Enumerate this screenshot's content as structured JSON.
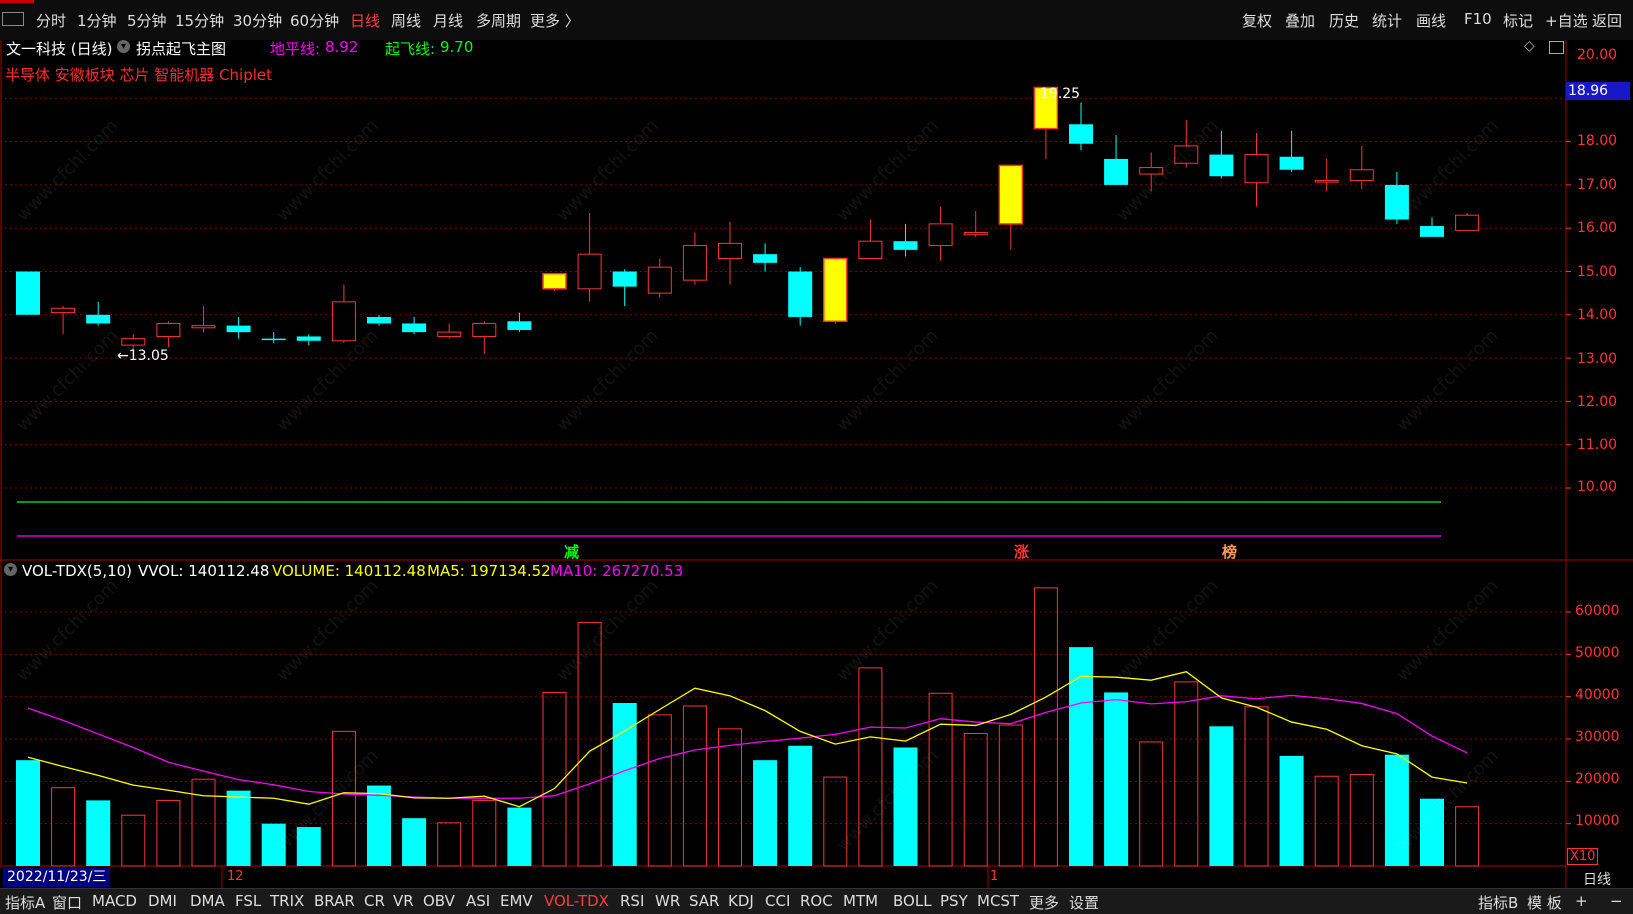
{
  "toolbar": {
    "periods": [
      "分时",
      "1分钟",
      "5分钟",
      "15分钟",
      "30分钟",
      "60分钟",
      "日线",
      "周线",
      "月线",
      "多周期",
      "更多 〉"
    ],
    "active_period": "日线",
    "right": [
      "复权",
      "叠加",
      "历史",
      "统计",
      "画线",
      "F10",
      "标记",
      "+自选",
      "返回"
    ]
  },
  "stock": {
    "title": "文一科技 (日线)",
    "main_chart": "拐点起飞主图",
    "floor_line_label": "地平线:",
    "floor_line_value": "8.92",
    "takeoff_line_label": "起飞线:",
    "takeoff_line_value": "9.70",
    "concepts": "半导体 安徽板块 芯片 智能机器 Chiplet",
    "last_price": "18.96",
    "high_label": "19.25",
    "low_label": "←13.05"
  },
  "indicator": {
    "name": "VOL-TDX(5,10)",
    "vvol": "VVOL: 140112.48",
    "volume": "VOLUME: 140112.48",
    "ma5": "MA5: 197134.52",
    "ma10": "MA10: 267270.53",
    "x10": "X10"
  },
  "signals": {
    "reduce": "减",
    "rise": "涨",
    "list": "榜"
  },
  "date": "2022/11/23/三",
  "month_marks": [
    "12",
    "1"
  ],
  "period_label": "日线",
  "bottom_tabs": [
    "指标A",
    "窗口",
    "MACD",
    "DMI",
    "DMA",
    "FSL",
    "TRIX",
    "BRAR",
    "CR",
    "VR",
    "OBV",
    "ASI",
    "EMV",
    "VOL-TDX",
    "RSI",
    "WR",
    "SAR",
    "KDJ",
    "CCI",
    "ROC",
    "MTM",
    "BOLL",
    "PSY",
    "MCST",
    "更多",
    "设置"
  ],
  "active_tab": "VOL-TDX",
  "bottom_right": [
    "指标B",
    "模 板",
    "+",
    "−"
  ],
  "watermark": "www.cfchi.com",
  "colors": {
    "up": "#ff3333",
    "down": "#00ffff",
    "yellow": "#ffff00",
    "magenta": "#ff00ff",
    "green": "#00ff00"
  },
  "chart_data": {
    "type": "candlestick",
    "price_axis": {
      "ylim": [
        9.0,
        20.4
      ],
      "ticks": [
        "10.00",
        "11.00",
        "12.00",
        "13.00",
        "14.00",
        "15.00",
        "16.00",
        "17.00",
        "18.00",
        "19.00",
        "20.00"
      ]
    },
    "volume_axis": {
      "ylim": [
        0,
        70000
      ],
      "ticks": [
        "10000",
        "20000",
        "30000",
        "40000",
        "50000",
        "60000"
      ],
      "unit": "X10"
    },
    "ohlc": [
      [
        15.0,
        15.0,
        14.0,
        14.0,
        "cyan"
      ],
      [
        14.05,
        14.2,
        13.55,
        14.15,
        "red"
      ],
      [
        14.0,
        14.3,
        13.75,
        13.8,
        "cyan"
      ],
      [
        13.3,
        13.55,
        13.05,
        13.45,
        "red"
      ],
      [
        13.5,
        13.85,
        13.25,
        13.8,
        "red"
      ],
      [
        13.7,
        14.2,
        13.6,
        13.75,
        "red"
      ],
      [
        13.75,
        13.95,
        13.45,
        13.6,
        "cyan"
      ],
      [
        13.45,
        13.6,
        13.35,
        13.45,
        "cyan"
      ],
      [
        13.4,
        13.55,
        13.3,
        13.5,
        "cyan"
      ],
      [
        13.4,
        14.7,
        13.35,
        14.3,
        "red"
      ],
      [
        13.95,
        14.0,
        13.75,
        13.8,
        "cyan"
      ],
      [
        13.8,
        13.95,
        13.55,
        13.6,
        "cyan"
      ],
      [
        13.5,
        13.8,
        13.45,
        13.6,
        "red"
      ],
      [
        13.5,
        13.85,
        13.1,
        13.8,
        "red"
      ],
      [
        13.85,
        14.05,
        13.6,
        13.65,
        "cyan"
      ],
      [
        14.6,
        14.95,
        14.55,
        14.95,
        "yellow"
      ],
      [
        14.6,
        16.35,
        14.3,
        15.4,
        "red"
      ],
      [
        15.0,
        15.05,
        14.2,
        14.65,
        "cyan"
      ],
      [
        14.5,
        15.3,
        14.4,
        15.1,
        "red"
      ],
      [
        14.8,
        15.9,
        14.7,
        15.6,
        "red"
      ],
      [
        15.3,
        16.15,
        14.7,
        15.65,
        "red"
      ],
      [
        15.4,
        15.65,
        15.0,
        15.2,
        "cyan"
      ],
      [
        15.0,
        15.1,
        13.75,
        13.95,
        "cyan"
      ],
      [
        13.85,
        15.3,
        13.8,
        15.3,
        "yellow"
      ],
      [
        15.3,
        16.2,
        15.3,
        15.7,
        "red"
      ],
      [
        15.7,
        16.1,
        15.35,
        15.5,
        "cyan"
      ],
      [
        15.6,
        16.5,
        15.25,
        16.1,
        "red"
      ],
      [
        15.85,
        16.4,
        15.8,
        15.9,
        "red"
      ],
      [
        16.1,
        17.45,
        15.5,
        17.45,
        "yellow"
      ],
      [
        18.3,
        19.25,
        17.6,
        19.25,
        "yellow"
      ],
      [
        18.4,
        18.9,
        17.8,
        17.95,
        "cyan"
      ],
      [
        17.6,
        18.15,
        17.0,
        17.0,
        "cyan"
      ],
      [
        17.25,
        17.75,
        16.85,
        17.4,
        "red"
      ],
      [
        17.5,
        18.5,
        17.4,
        17.9,
        "red"
      ],
      [
        17.7,
        18.25,
        17.15,
        17.2,
        "cyan"
      ],
      [
        17.05,
        18.2,
        16.5,
        17.7,
        "red"
      ],
      [
        17.65,
        18.25,
        17.3,
        17.35,
        "cyan"
      ],
      [
        17.1,
        17.6,
        16.85,
        17.1,
        "red"
      ],
      [
        17.1,
        17.9,
        16.9,
        17.35,
        "red"
      ],
      [
        17.0,
        17.3,
        16.1,
        16.2,
        "cyan"
      ],
      [
        16.05,
        16.25,
        15.8,
        15.8,
        "cyan"
      ],
      [
        15.95,
        16.35,
        15.95,
        16.3,
        "red"
      ]
    ],
    "volume": [
      [
        25000,
        "cyan"
      ],
      [
        18500,
        "red"
      ],
      [
        15500,
        "cyan"
      ],
      [
        12000,
        "red"
      ],
      [
        15500,
        "red"
      ],
      [
        20500,
        "red"
      ],
      [
        17800,
        "cyan"
      ],
      [
        10000,
        "cyan"
      ],
      [
        9200,
        "cyan"
      ],
      [
        31800,
        "red"
      ],
      [
        19000,
        "cyan"
      ],
      [
        11300,
        "cyan"
      ],
      [
        10200,
        "red"
      ],
      [
        15500,
        "red"
      ],
      [
        13800,
        "cyan"
      ],
      [
        41000,
        "red"
      ],
      [
        57500,
        "red"
      ],
      [
        38500,
        "cyan"
      ],
      [
        35700,
        "red"
      ],
      [
        37800,
        "red"
      ],
      [
        32400,
        "red"
      ],
      [
        25000,
        "cyan"
      ],
      [
        28400,
        "cyan"
      ],
      [
        21000,
        "red"
      ],
      [
        46800,
        "red"
      ],
      [
        28000,
        "cyan"
      ],
      [
        40800,
        "red"
      ],
      [
        31300,
        "red"
      ],
      [
        33300,
        "red"
      ],
      [
        65700,
        "red"
      ],
      [
        51700,
        "cyan"
      ],
      [
        41000,
        "cyan"
      ],
      [
        29300,
        "red"
      ],
      [
        43500,
        "red"
      ],
      [
        33000,
        "cyan"
      ],
      [
        37600,
        "red"
      ],
      [
        26000,
        "cyan"
      ],
      [
        21200,
        "red"
      ],
      [
        21600,
        "red"
      ],
      [
        26300,
        "cyan"
      ],
      [
        15900,
        "cyan"
      ],
      [
        14000,
        "red"
      ]
    ],
    "ma5": [
      25700,
      23500,
      21400,
      19100,
      17900,
      16600,
      16300,
      16000,
      14600,
      17300,
      17100,
      16100,
      16000,
      16500,
      14000,
      18300,
      27100,
      31900,
      37000,
      42000,
      40200,
      36700,
      31800,
      28800,
      30500,
      29500,
      33500,
      33200,
      35800,
      39900,
      44800,
      44600,
      43900,
      45900,
      39700,
      37500,
      34000,
      32300,
      28400,
      26500,
      21000,
      19600
    ],
    "ma10": [
      37300,
      34400,
      31200,
      28000,
      24500,
      22400,
      20400,
      19200,
      17600,
      17000,
      16700,
      16300,
      16000,
      16000,
      16000,
      16600,
      19400,
      22500,
      25400,
      27400,
      28500,
      29400,
      30200,
      31100,
      32800,
      32600,
      34800,
      34000,
      33600,
      36300,
      38500,
      39300,
      38300,
      38800,
      40200,
      39500,
      40300,
      39500,
      38400,
      36000,
      30700,
      26700
    ]
  }
}
